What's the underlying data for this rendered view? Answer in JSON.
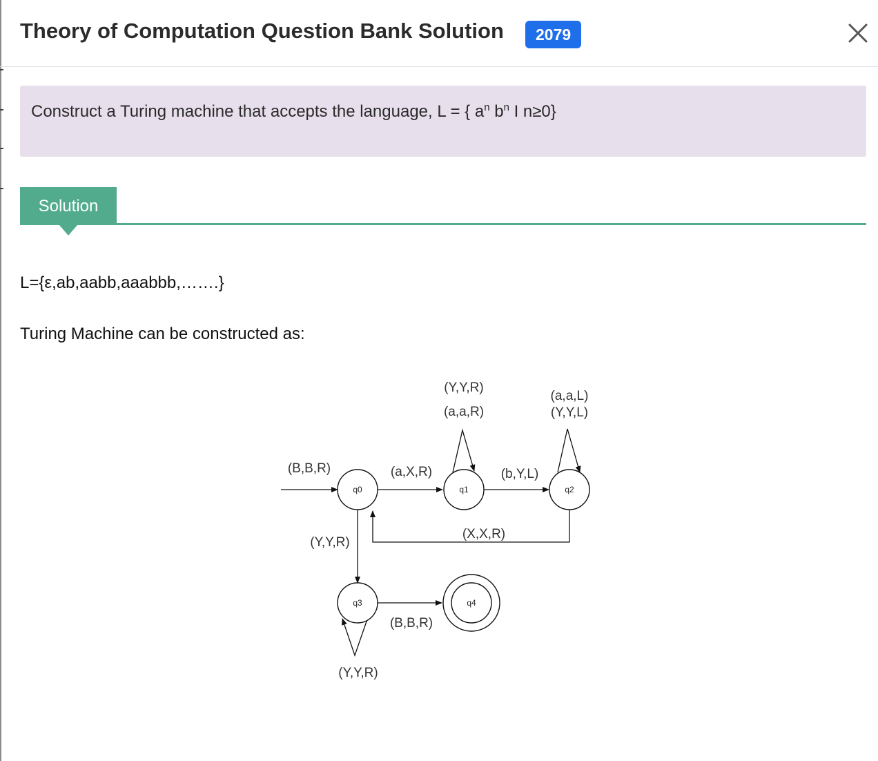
{
  "header": {
    "title": "Theory of Computation Question Bank Solution",
    "year_badge": "2079"
  },
  "question": {
    "text_before": "Construct a Turing machine that accepts the language, L = { a",
    "sup1": "n",
    "mid": " b",
    "sup2": "n",
    "text_after": " I n≥0}"
  },
  "solution": {
    "tab_label": "Solution",
    "language_line": "L={ε,ab,aabb,aaabbb,…….}",
    "construct_line": "Turing Machine can be constructed as:"
  },
  "diagram": {
    "states": {
      "q0": "q0",
      "q1": "q1",
      "q2": "q2",
      "q3": "q3",
      "q4": "q4"
    },
    "transitions": {
      "start": "(B,B,R)",
      "q0_q1": "(a,X,R)",
      "q1_self_1": "(Y,Y,R)",
      "q1_self_2": "(a,a,R)",
      "q1_q2": "(b,Y,L)",
      "q2_self_1": "(a,a,L)",
      "q2_self_2": "(Y,Y,L)",
      "q2_q0": "(X,X,R)",
      "q0_q3": "(Y,Y,R)",
      "q3_q4": "(B,B,R)",
      "q3_self": "(Y,Y,R)"
    }
  },
  "icons": {
    "close": "close-icon"
  }
}
